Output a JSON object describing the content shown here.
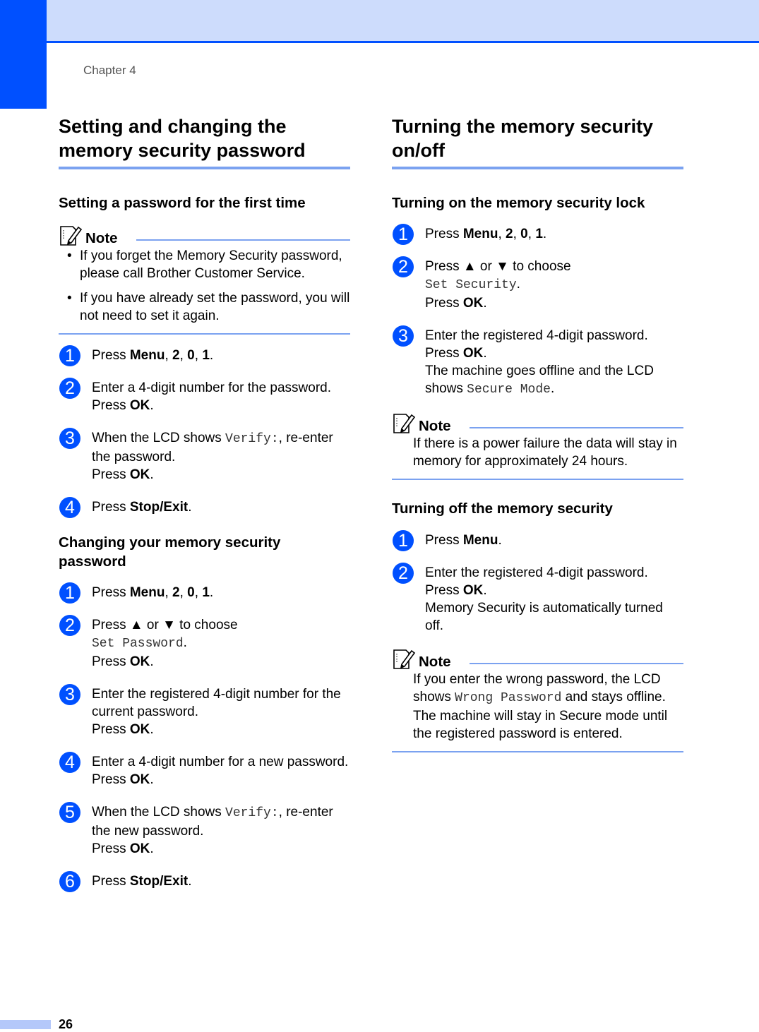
{
  "header": {
    "chapter": "Chapter 4",
    "colors": {
      "accent": "#0050ff",
      "band": "#cddcfc",
      "rule": "#7ba2f0"
    }
  },
  "left": {
    "title": "Setting and changing the memory security password",
    "section1": {
      "heading": "Setting a password for the first time",
      "note": {
        "label": "Note",
        "icon": "note-pencil-icon",
        "bullets": [
          "If you forget the Memory Security password, please call Brother Customer Service.",
          "If you have already set the password, you will not need to set it again."
        ]
      },
      "steps": [
        {
          "num": "1",
          "parts": [
            [
              "t",
              "Press "
            ],
            [
              "b",
              "Menu"
            ],
            [
              "t",
              ", "
            ],
            [
              "b",
              "2"
            ],
            [
              "t",
              ", "
            ],
            [
              "b",
              "0"
            ],
            [
              "t",
              ", "
            ],
            [
              "b",
              "1"
            ],
            [
              "t",
              "."
            ]
          ]
        },
        {
          "num": "2",
          "parts": [
            [
              "t",
              "Enter a 4-digit number for the password."
            ],
            [
              "br",
              ""
            ],
            [
              "t",
              "Press "
            ],
            [
              "b",
              "OK"
            ],
            [
              "t",
              "."
            ]
          ]
        },
        {
          "num": "3",
          "parts": [
            [
              "t",
              "When the LCD shows "
            ],
            [
              "m",
              "Verify:"
            ],
            [
              "t",
              ", re-enter the password."
            ],
            [
              "br",
              ""
            ],
            [
              "t",
              "Press "
            ],
            [
              "b",
              "OK"
            ],
            [
              "t",
              "."
            ]
          ]
        },
        {
          "num": "4",
          "parts": [
            [
              "t",
              "Press "
            ],
            [
              "b",
              "Stop/Exit"
            ],
            [
              "t",
              "."
            ]
          ]
        }
      ]
    },
    "section2": {
      "heading": "Changing your memory security password",
      "steps": [
        {
          "num": "1",
          "parts": [
            [
              "t",
              "Press "
            ],
            [
              "b",
              "Menu"
            ],
            [
              "t",
              ", "
            ],
            [
              "b",
              "2"
            ],
            [
              "t",
              ", "
            ],
            [
              "b",
              "0"
            ],
            [
              "t",
              ", "
            ],
            [
              "b",
              "1"
            ],
            [
              "t",
              "."
            ]
          ]
        },
        {
          "num": "2",
          "parts": [
            [
              "t",
              "Press ▲ or ▼ to choose"
            ],
            [
              "br",
              ""
            ],
            [
              "m",
              "Set Password"
            ],
            [
              "t",
              "."
            ],
            [
              "br",
              ""
            ],
            [
              "t",
              "Press "
            ],
            [
              "b",
              "OK"
            ],
            [
              "t",
              "."
            ]
          ]
        },
        {
          "num": "3",
          "parts": [
            [
              "t",
              "Enter the registered 4-digit number for the current password."
            ],
            [
              "br",
              ""
            ],
            [
              "t",
              "Press "
            ],
            [
              "b",
              "OK"
            ],
            [
              "t",
              "."
            ]
          ]
        },
        {
          "num": "4",
          "parts": [
            [
              "t",
              "Enter a 4-digit number for a new password."
            ],
            [
              "br",
              ""
            ],
            [
              "t",
              "Press "
            ],
            [
              "b",
              "OK"
            ],
            [
              "t",
              "."
            ]
          ]
        },
        {
          "num": "5",
          "parts": [
            [
              "t",
              "When the LCD shows "
            ],
            [
              "m",
              "Verify:"
            ],
            [
              "t",
              ", re-enter the new password."
            ],
            [
              "br",
              ""
            ],
            [
              "t",
              "Press "
            ],
            [
              "b",
              "OK"
            ],
            [
              "t",
              "."
            ]
          ]
        },
        {
          "num": "6",
          "parts": [
            [
              "t",
              "Press "
            ],
            [
              "b",
              "Stop/Exit"
            ],
            [
              "t",
              "."
            ]
          ]
        }
      ]
    }
  },
  "right": {
    "title": "Turning the memory security on/off",
    "section1": {
      "heading": "Turning on the memory security lock",
      "steps": [
        {
          "num": "1",
          "parts": [
            [
              "t",
              "Press "
            ],
            [
              "b",
              "Menu"
            ],
            [
              "t",
              ", "
            ],
            [
              "b",
              "2"
            ],
            [
              "t",
              ", "
            ],
            [
              "b",
              "0"
            ],
            [
              "t",
              ", "
            ],
            [
              "b",
              "1"
            ],
            [
              "t",
              "."
            ]
          ]
        },
        {
          "num": "2",
          "parts": [
            [
              "t",
              "Press ▲ or ▼ to choose"
            ],
            [
              "br",
              ""
            ],
            [
              "m",
              "Set Security"
            ],
            [
              "t",
              "."
            ],
            [
              "br",
              ""
            ],
            [
              "t",
              "Press "
            ],
            [
              "b",
              "OK"
            ],
            [
              "t",
              "."
            ]
          ]
        },
        {
          "num": "3",
          "parts": [
            [
              "t",
              "Enter the registered 4-digit password."
            ],
            [
              "br",
              ""
            ],
            [
              "t",
              "Press "
            ],
            [
              "b",
              "OK"
            ],
            [
              "t",
              "."
            ],
            [
              "br",
              ""
            ],
            [
              "t",
              "The machine goes offline and the LCD shows "
            ],
            [
              "m",
              "Secure Mode"
            ],
            [
              "t",
              "."
            ]
          ]
        }
      ],
      "note": {
        "label": "Note",
        "icon": "note-pencil-icon",
        "parts": [
          [
            "t",
            "If there is a power failure the data will stay in memory for approximately 24 hours."
          ]
        ]
      }
    },
    "section2": {
      "heading": "Turning off the memory security",
      "steps": [
        {
          "num": "1",
          "parts": [
            [
              "t",
              "Press "
            ],
            [
              "b",
              "Menu"
            ],
            [
              "t",
              "."
            ]
          ]
        },
        {
          "num": "2",
          "parts": [
            [
              "t",
              "Enter the registered 4-digit password."
            ],
            [
              "br",
              ""
            ],
            [
              "t",
              "Press "
            ],
            [
              "b",
              "OK"
            ],
            [
              "t",
              "."
            ],
            [
              "br",
              ""
            ],
            [
              "t",
              "Memory Security is automatically turned off."
            ]
          ]
        }
      ],
      "note": {
        "label": "Note",
        "icon": "note-pencil-icon",
        "parts": [
          [
            "t",
            "If you enter the wrong password, the LCD shows "
          ],
          [
            "m",
            "Wrong Password"
          ],
          [
            "t",
            " and stays offline. The machine will stay in Secure mode until the registered password is entered."
          ]
        ]
      }
    }
  },
  "footer": {
    "page_number": "26"
  }
}
